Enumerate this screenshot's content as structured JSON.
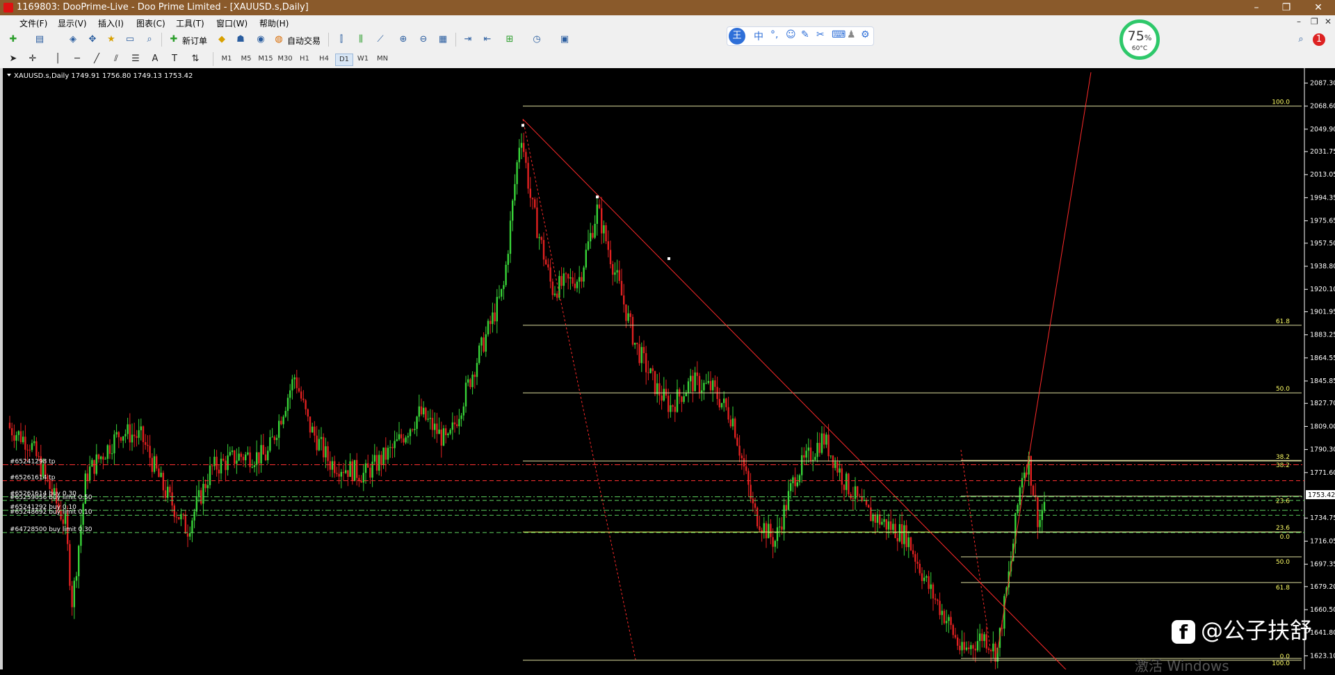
{
  "window": {
    "title": "1169803: DooPrime-Live - Doo Prime Limited - [XAUUSD.s,Daily]",
    "controls": [
      "–",
      "❐",
      "✕"
    ]
  },
  "menu": {
    "items": [
      "文件(F)",
      "显示(V)",
      "插入(I)",
      "图表(C)",
      "工具(T)",
      "窗口(W)",
      "帮助(H)"
    ],
    "mdi_controls": [
      "–",
      "❐",
      "✕"
    ]
  },
  "toolbar": {
    "new_order": "新订单",
    "auto_trading": "自动交易",
    "timeframes": [
      "M1",
      "M5",
      "M15",
      "M30",
      "H1",
      "H4",
      "D1",
      "W1",
      "MN"
    ],
    "active_timeframe": "D1"
  },
  "ime": {
    "brand": "王",
    "mode": "中",
    "punct": "°,",
    "icons": [
      "smile-icon",
      "pen-icon",
      "scissors-icon",
      "keyboard-icon",
      "user-icon",
      "shirt-icon",
      "gear-icon"
    ]
  },
  "cpu_gauge": {
    "percent": "75",
    "unit": "%",
    "temp": "60°C"
  },
  "notification_count": "1",
  "chart": {
    "info": "XAUUSD.s,Daily  1749.91 1756.80 1749.13 1753.42",
    "current_price": "1753.42",
    "price_axis": [
      "2087.30",
      "2068.60",
      "2049.90",
      "2031.75",
      "2013.05",
      "1994.35",
      "1975.65",
      "1957.50",
      "1938.80",
      "1920.10",
      "1901.95",
      "1883.25",
      "1864.55",
      "1845.85",
      "1827.70",
      "1809.00",
      "1790.30",
      "1771.60",
      "1753.42",
      "1734.75",
      "1716.05",
      "1697.35",
      "1679.20",
      "1660.50",
      "1641.80",
      "1623.10"
    ],
    "axis_min": 1616,
    "axis_max": 2096,
    "fib_levels_a": [
      {
        "label": "100.0",
        "price": 2068.6
      },
      {
        "label": "61.8",
        "price": 1891.0
      },
      {
        "label": "50.0",
        "price": 1836.2
      },
      {
        "label": "38.2",
        "price": 1781.0
      },
      {
        "label": "23.6",
        "price": 1723.5
      },
      {
        "label": "0.0",
        "price": 1619.5
      }
    ],
    "fib_levels_b": [
      {
        "label": "38.2",
        "price": 1781.5
      },
      {
        "label": "23.6",
        "price": 1752.5
      },
      {
        "label": "0.0",
        "price": 1723.5
      },
      {
        "label": "50.0",
        "price": 1703.3
      },
      {
        "label": "61.8",
        "price": 1682.5
      },
      {
        "label": "100.0",
        "price": 1621.0
      }
    ],
    "orders": [
      {
        "label": "#65241298 tp",
        "price": 1778.0,
        "color": "#ff3030",
        "style": "dashdot"
      },
      {
        "label": "#65261614 tp",
        "price": 1765.0,
        "color": "#ff3030",
        "style": "dashed"
      },
      {
        "label": "#65261614 buy 0.30",
        "price": 1752.0,
        "color": "#5fd35f",
        "style": "dashdot"
      },
      {
        "label": "#65259056 buy limit 0.50",
        "price": 1749.0,
        "color": "#5fd35f",
        "style": "dashed"
      },
      {
        "label": "#65241292 buy 0.10",
        "price": 1741.0,
        "color": "#5fd35f",
        "style": "dashdot"
      },
      {
        "label": "#65248692 buy limit 0.10",
        "price": 1737.0,
        "color": "#5fd35f",
        "style": "dashed"
      },
      {
        "label": "#64728500 buy limit 0.30",
        "price": 1723.0,
        "color": "#5fd35f",
        "style": "dashed"
      }
    ]
  },
  "watermark": {
    "logo": "f",
    "text": "@公子扶舒"
  },
  "os_overlay": "激活 Windows"
}
